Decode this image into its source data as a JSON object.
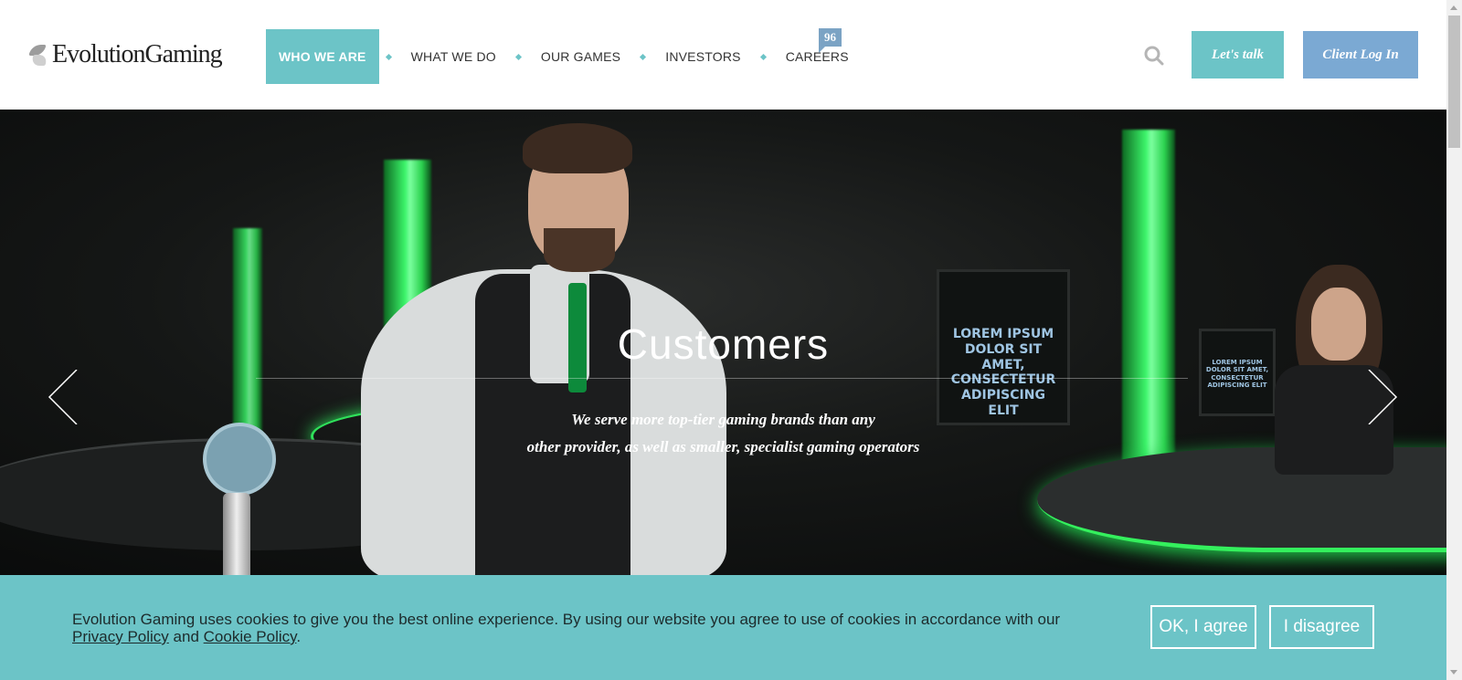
{
  "header": {
    "logo_text": "EvolutionGaming",
    "nav": [
      {
        "label": "WHO WE ARE"
      },
      {
        "label": "WHAT WE DO"
      },
      {
        "label": "OUR GAMES"
      },
      {
        "label": "INVESTORS"
      },
      {
        "label": "CAREERS"
      }
    ],
    "careers_badge": "96",
    "search_icon": "search-icon",
    "talk_label": "Let's talk",
    "login_label": "Client Log In"
  },
  "hero": {
    "title": "Customers",
    "subtitle_line1": "We serve more top-tier gaming brands than any",
    "subtitle_line2": "other provider, as well as smaller, specialist gaming operators",
    "screen_text": "LOREM IPSUM DOLOR SIT AMET, CONSECTETUR ADIPISCING ELIT",
    "prev_icon": "chevron-left-icon",
    "next_icon": "chevron-right-icon"
  },
  "cookie": {
    "text": "Evolution Gaming uses cookies to give you the best online experience. By using our website you agree to use of cookies in accordance with our",
    "privacy_link": "Privacy Policy",
    "and_text": "and",
    "cookie_link": "Cookie Policy",
    "period": ".",
    "agree_label": "OK, I agree",
    "disagree_label": "I disagree"
  },
  "colors": {
    "accent_teal": "#6cc4c7",
    "login_blue": "#7ba9d3",
    "badge_blue": "#7ba3c4",
    "neon_green": "#2fe05a"
  }
}
